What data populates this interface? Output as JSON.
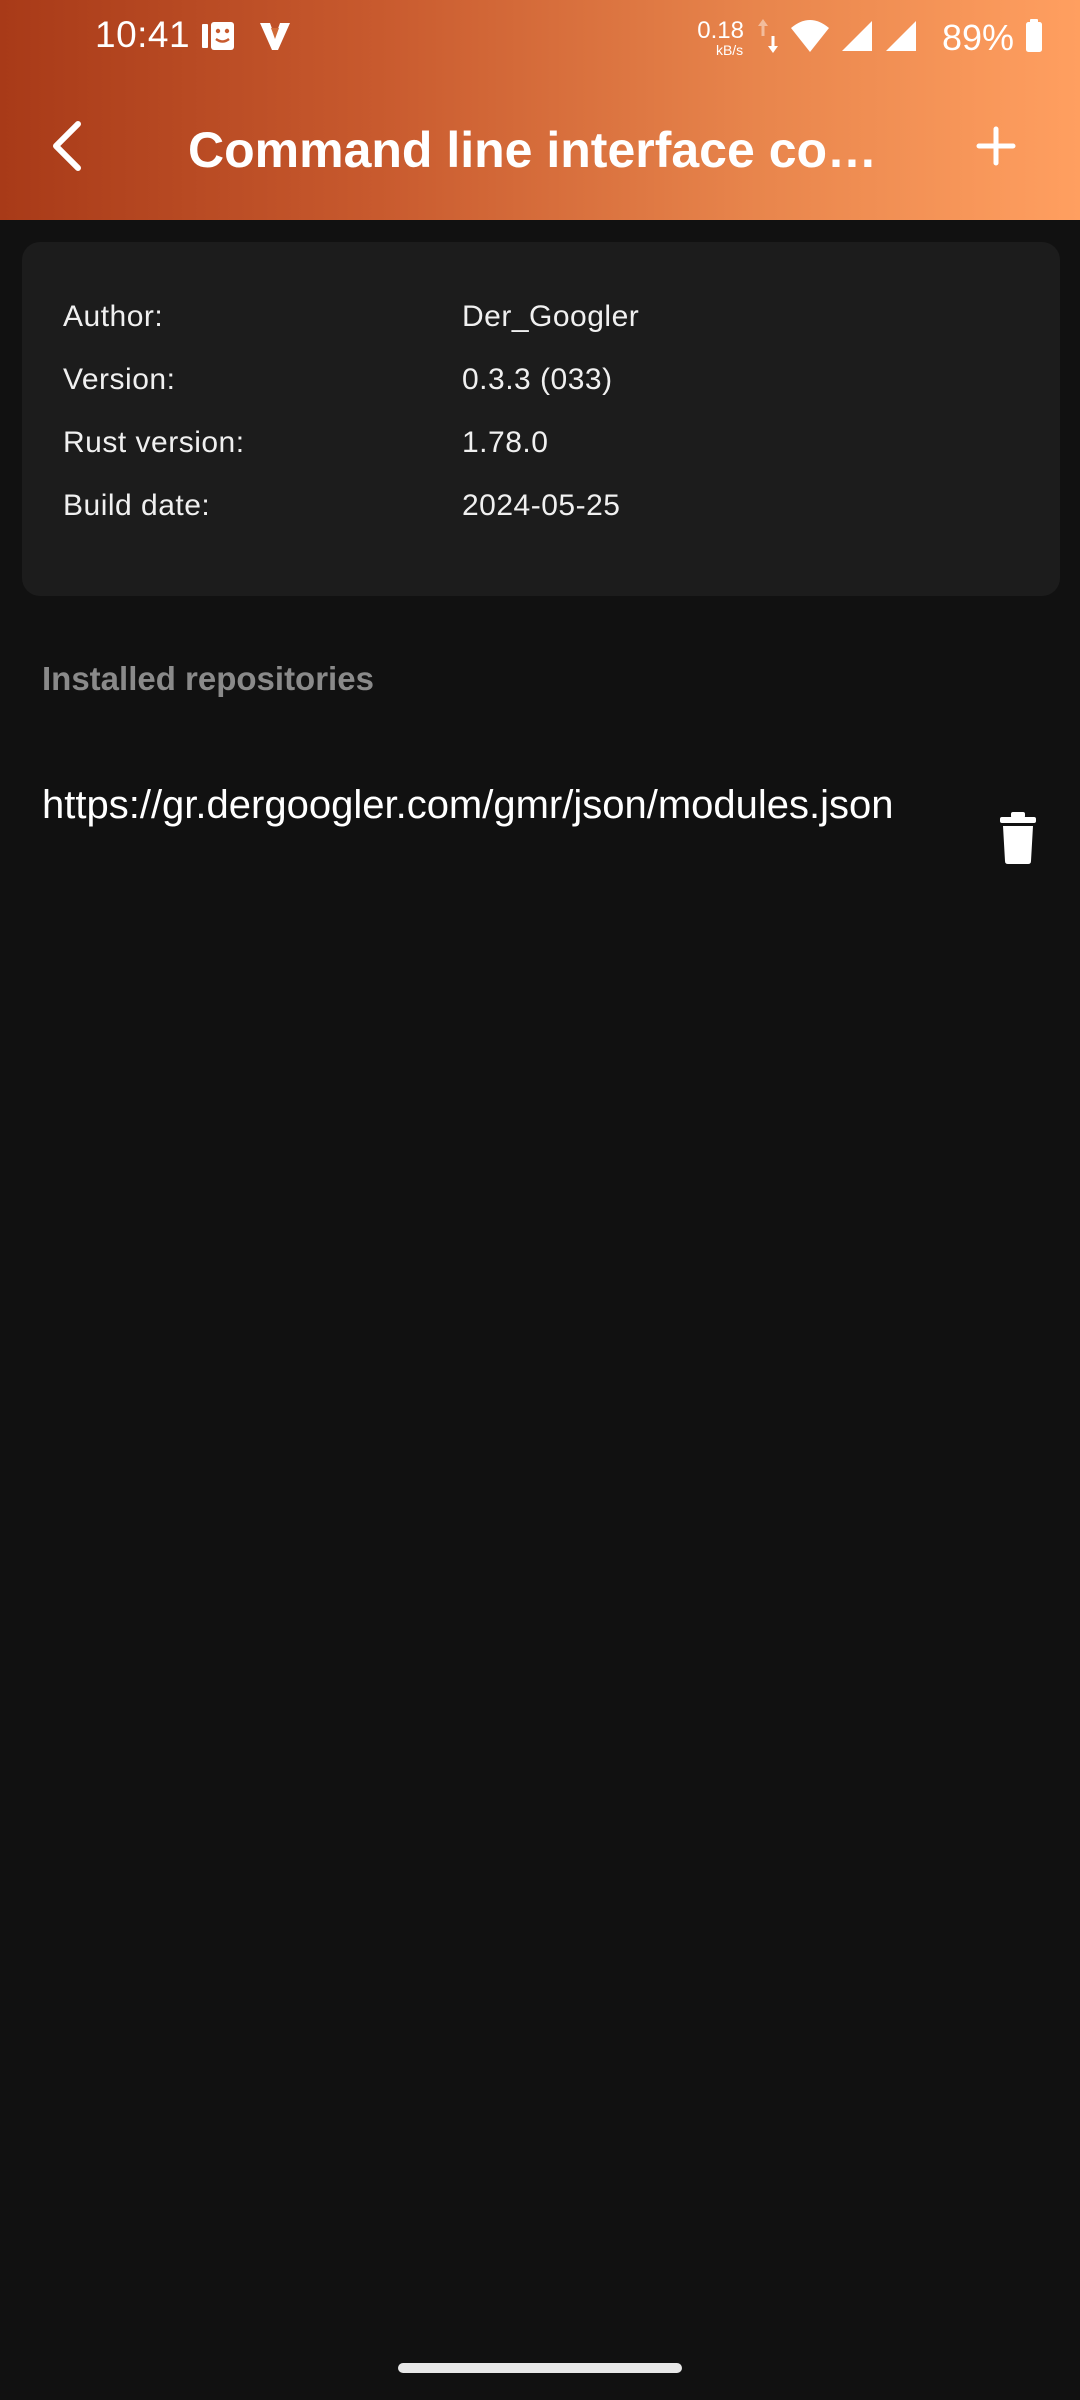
{
  "status_bar": {
    "time": "10:41",
    "net_speed_value": "0.18",
    "net_speed_unit": "kB/s",
    "battery_percent": "89%"
  },
  "toolbar": {
    "title": "Command line interface co…"
  },
  "info": {
    "rows": [
      {
        "label": "Author:",
        "value": "Der_Googler"
      },
      {
        "label": "Version:",
        "value": "0.3.3 (033)"
      },
      {
        "label": "Rust version:",
        "value": "1.78.0"
      },
      {
        "label": "Build date:",
        "value": "2024-05-25"
      }
    ]
  },
  "repositories": {
    "header": "Installed repositories",
    "items": [
      {
        "url": "https://gr.dergoogler.com/gmr/json/modules.json"
      }
    ]
  },
  "colors": {
    "appbar_start": "#a83a18",
    "appbar_end": "#ff9f60",
    "background": "#111111",
    "card": "#1c1c1c",
    "section_header": "#8a8a8a"
  },
  "icons": {
    "back": "arrow-back-icon",
    "add": "plus-icon",
    "delete": "trash-icon",
    "wifi": "wifi-icon",
    "signal": "cell-signal-icon",
    "battery": "battery-icon"
  }
}
